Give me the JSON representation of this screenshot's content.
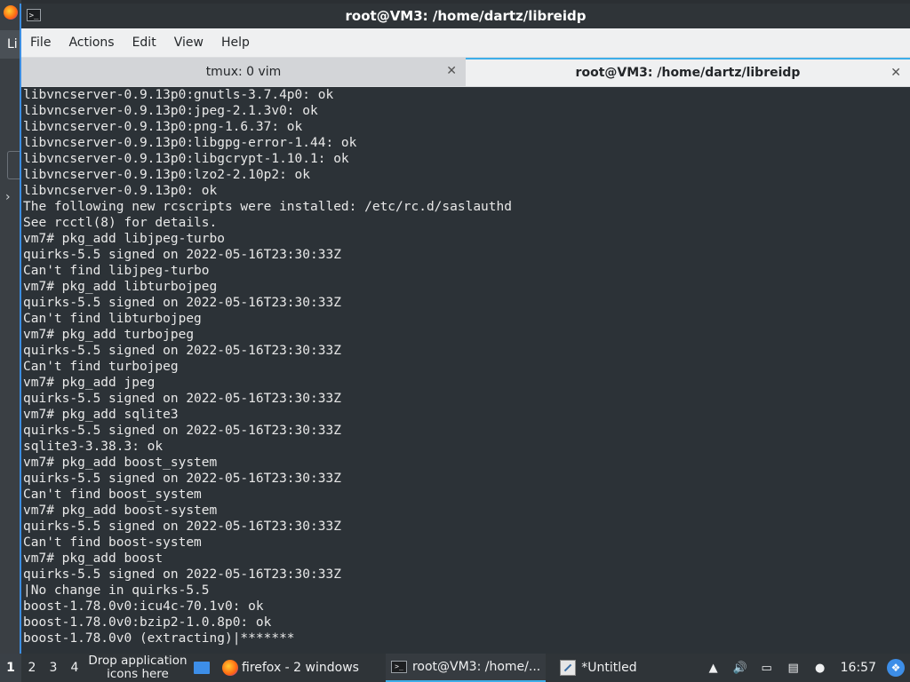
{
  "window": {
    "title": "root@VM3: /home/dartz/libreidp",
    "icon": "terminal-icon"
  },
  "background": {
    "tab_label": "Li",
    "arrow": "›"
  },
  "menubar": {
    "items": [
      "File",
      "Actions",
      "Edit",
      "View",
      "Help"
    ]
  },
  "tabs": [
    {
      "label": "tmux: 0 vim",
      "active": false
    },
    {
      "label": "root@VM3: /home/dartz/libreidp",
      "active": true
    }
  ],
  "terminal": {
    "lines": [
      "libvncserver-0.9.13p0:gnutls-3.7.4p0: ok",
      "libvncserver-0.9.13p0:jpeg-2.1.3v0: ok",
      "libvncserver-0.9.13p0:png-1.6.37: ok",
      "libvncserver-0.9.13p0:libgpg-error-1.44: ok",
      "libvncserver-0.9.13p0:libgcrypt-1.10.1: ok",
      "libvncserver-0.9.13p0:lzo2-2.10p2: ok",
      "libvncserver-0.9.13p0: ok",
      "The following new rcscripts were installed: /etc/rc.d/saslauthd",
      "See rcctl(8) for details.",
      "vm7# pkg_add libjpeg-turbo",
      "quirks-5.5 signed on 2022-05-16T23:30:33Z",
      "Can't find libjpeg-turbo",
      "vm7# pkg_add libturbojpeg",
      "quirks-5.5 signed on 2022-05-16T23:30:33Z",
      "Can't find libturbojpeg",
      "vm7# pkg_add turbojpeg",
      "quirks-5.5 signed on 2022-05-16T23:30:33Z",
      "Can't find turbojpeg",
      "vm7# pkg_add jpeg",
      "quirks-5.5 signed on 2022-05-16T23:30:33Z",
      "vm7# pkg_add sqlite3",
      "quirks-5.5 signed on 2022-05-16T23:30:33Z",
      "sqlite3-3.38.3: ok",
      "vm7# pkg_add boost_system",
      "quirks-5.5 signed on 2022-05-16T23:30:33Z",
      "Can't find boost_system",
      "vm7# pkg_add boost-system",
      "quirks-5.5 signed on 2022-05-16T23:30:33Z",
      "Can't find boost-system",
      "vm7# pkg_add boost",
      "quirks-5.5 signed on 2022-05-16T23:30:33Z",
      "|No change in quirks-5.5",
      "boost-1.78.0v0:icu4c-70.1v0: ok",
      "boost-1.78.0v0:bzip2-1.0.8p0: ok",
      "boost-1.78.0v0 (extracting)|*******"
    ]
  },
  "taskbar": {
    "desktops": [
      "1",
      "2",
      "3",
      "4"
    ],
    "active_desktop": "1",
    "drop_hint": "Drop application icons here",
    "tasks": [
      {
        "label": "firefox - 2 windows",
        "icon": "firefox-icon"
      },
      {
        "label": "root@VM3: /home/...",
        "icon": "terminal-icon",
        "active": true
      },
      {
        "label": "*Untitled",
        "icon": "text-editor-icon"
      }
    ],
    "tray": [
      "upload-icon",
      "volume-icon",
      "network-icon",
      "clipboard-icon",
      "notification-icon"
    ],
    "clock": "16:57",
    "system_icon": "system-menu-icon"
  },
  "colors": {
    "accent": "#3daee9",
    "terminal_bg": "#2c3237",
    "terminal_fg": "#e8e8e8"
  }
}
